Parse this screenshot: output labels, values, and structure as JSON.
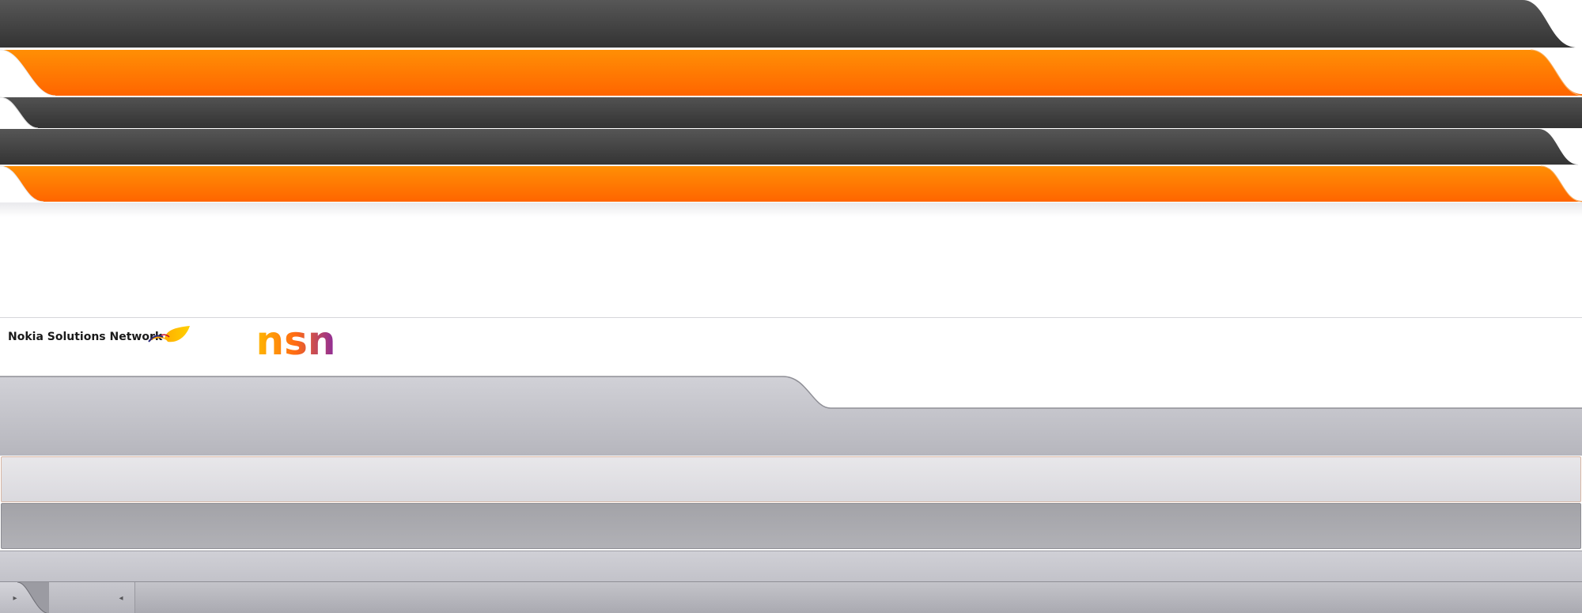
{
  "brand": {
    "company_name": "Nokia Solutions Network",
    "logo_text": "nsn"
  },
  "colors": {
    "dark_band": "#3a3a3a",
    "orange_band": "#ff7a00",
    "gray_panel": "#c6c6cc",
    "logo_start": "#ffb400",
    "logo_end": "#8a2a9a"
  },
  "icons": {
    "swoosh": "brand-swoosh-icon",
    "scroll_right": "triangle-right",
    "scroll_left": "triangle-left"
  },
  "footer": {
    "scroll_right_glyph": "▸",
    "scroll_left_glyph": "◂"
  }
}
